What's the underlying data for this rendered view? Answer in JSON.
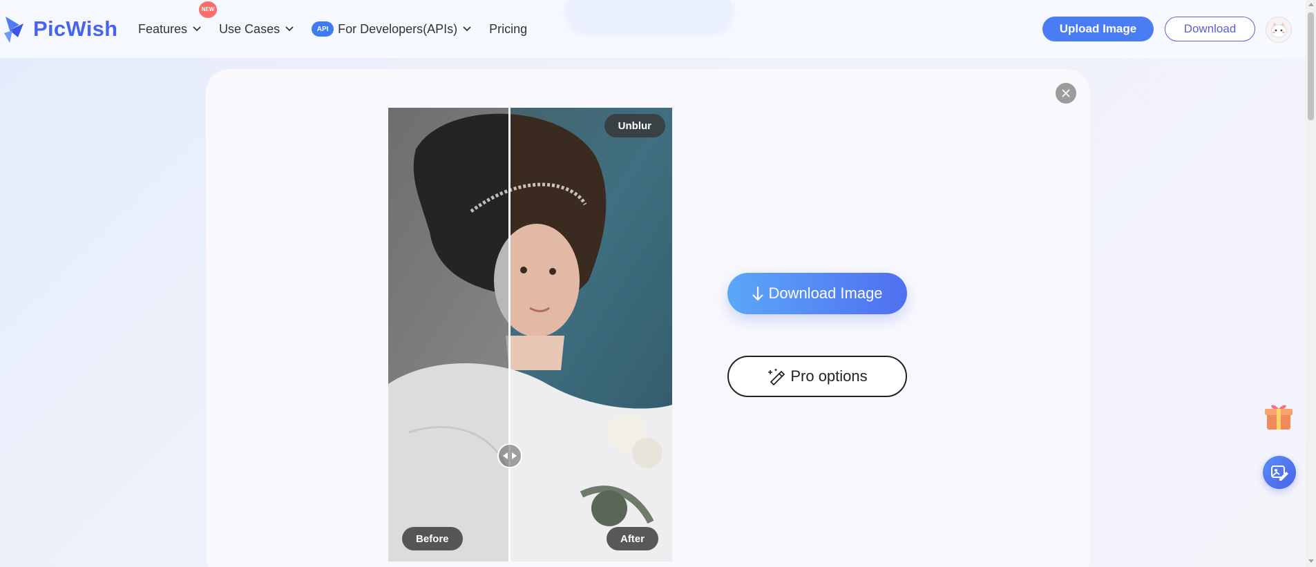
{
  "brand": {
    "name": "PicWish",
    "accent": "#4a63ee"
  },
  "nav": {
    "features": "Features",
    "new_badge": "NEW",
    "use_cases": "Use Cases",
    "api_badge": "API",
    "developers": "For Developers(APIs)",
    "pricing": "Pricing"
  },
  "header_actions": {
    "upload": "Upload Image",
    "download": "Download"
  },
  "compare": {
    "mode_label": "Unblur",
    "before_label": "Before",
    "after_label": "After",
    "divider_position": 0.43
  },
  "actions": {
    "download_image": "Download Image",
    "pro_options": "Pro options"
  },
  "icons": {
    "logo": "picwish-logo-icon",
    "chevron": "chevron-down-icon",
    "close": "close-icon",
    "download": "arrow-down-icon",
    "pro": "magic-pen-icon",
    "gift": "gift-icon",
    "editor": "image-edit-icon",
    "avatar": "avatar-icon"
  },
  "colors": {
    "primary_blue": "#4a7cf4",
    "download_outline": "#5a5fd6",
    "gradient_start": "#5ba7f8",
    "gradient_end": "#4f6ff0"
  }
}
